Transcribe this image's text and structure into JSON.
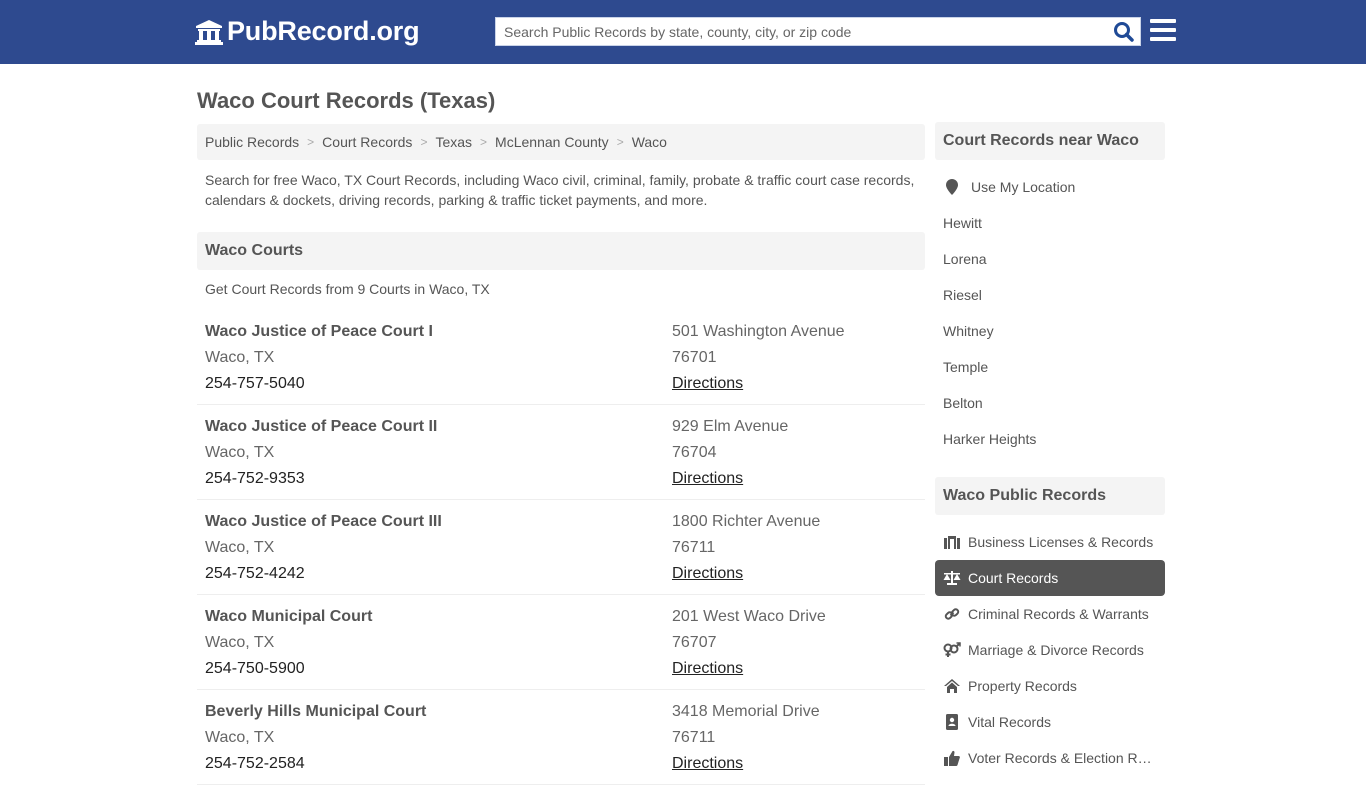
{
  "header": {
    "logo_text": "PubRecord.org",
    "search_placeholder": "Search Public Records by state, county, city, or zip code",
    "search_value": ""
  },
  "page": {
    "title": "Waco Court Records (Texas)",
    "breadcrumb": [
      "Public Records",
      "Court Records",
      "Texas",
      "McLennan County",
      "Waco"
    ],
    "intro": "Search for free Waco, TX Court Records, including Waco civil, criminal, family, probate & traffic court case records, calendars & dockets, driving records, parking & traffic ticket payments, and more."
  },
  "courts_section": {
    "title": "Waco Courts",
    "subtitle": "Get Court Records from 9 Courts in Waco, TX",
    "directions_label": "Directions",
    "courts": [
      {
        "name": "Waco Justice of Peace Court I",
        "city": "Waco, TX",
        "phone": "254-757-5040",
        "address": "501 Washington Avenue",
        "zip": "76701"
      },
      {
        "name": "Waco Justice of Peace Court II",
        "city": "Waco, TX",
        "phone": "254-752-9353",
        "address": "929 Elm Avenue",
        "zip": "76704"
      },
      {
        "name": "Waco Justice of Peace Court III",
        "city": "Waco, TX",
        "phone": "254-752-4242",
        "address": "1800 Richter Avenue",
        "zip": "76711"
      },
      {
        "name": "Waco Municipal Court",
        "city": "Waco, TX",
        "phone": "254-750-5900",
        "address": "201 West Waco Drive",
        "zip": "76707"
      },
      {
        "name": "Beverly Hills Municipal Court",
        "city": "Waco, TX",
        "phone": "254-752-2584",
        "address": "3418 Memorial Drive",
        "zip": "76711"
      }
    ]
  },
  "sidebar": {
    "near_title": "Court Records near Waco",
    "use_location": {
      "label": "Use My Location",
      "icon": "map-pin-icon"
    },
    "near_cities": [
      "Hewitt",
      "Lorena",
      "Riesel",
      "Whitney",
      "Temple",
      "Belton",
      "Harker Heights"
    ],
    "public_title": "Waco Public Records",
    "public_records": [
      {
        "label": "Business Licenses & Records",
        "icon": "briefcase-icon",
        "active": false
      },
      {
        "label": "Court Records",
        "icon": "balance-scale-icon",
        "active": true
      },
      {
        "label": "Criminal Records & Warrants",
        "icon": "link-icon",
        "active": false
      },
      {
        "label": "Marriage & Divorce Records",
        "icon": "venus-mars-icon",
        "active": false
      },
      {
        "label": "Property Records",
        "icon": "home-icon",
        "active": false
      },
      {
        "label": "Vital Records",
        "icon": "address-book-icon",
        "active": false
      },
      {
        "label": "Voter Records & Election Results",
        "icon": "thumbs-up-icon",
        "active": false
      }
    ]
  },
  "colors": {
    "header_bg": "#2e4a8f",
    "search_icon": "#1f4a96",
    "active_item_bg": "#555555"
  }
}
